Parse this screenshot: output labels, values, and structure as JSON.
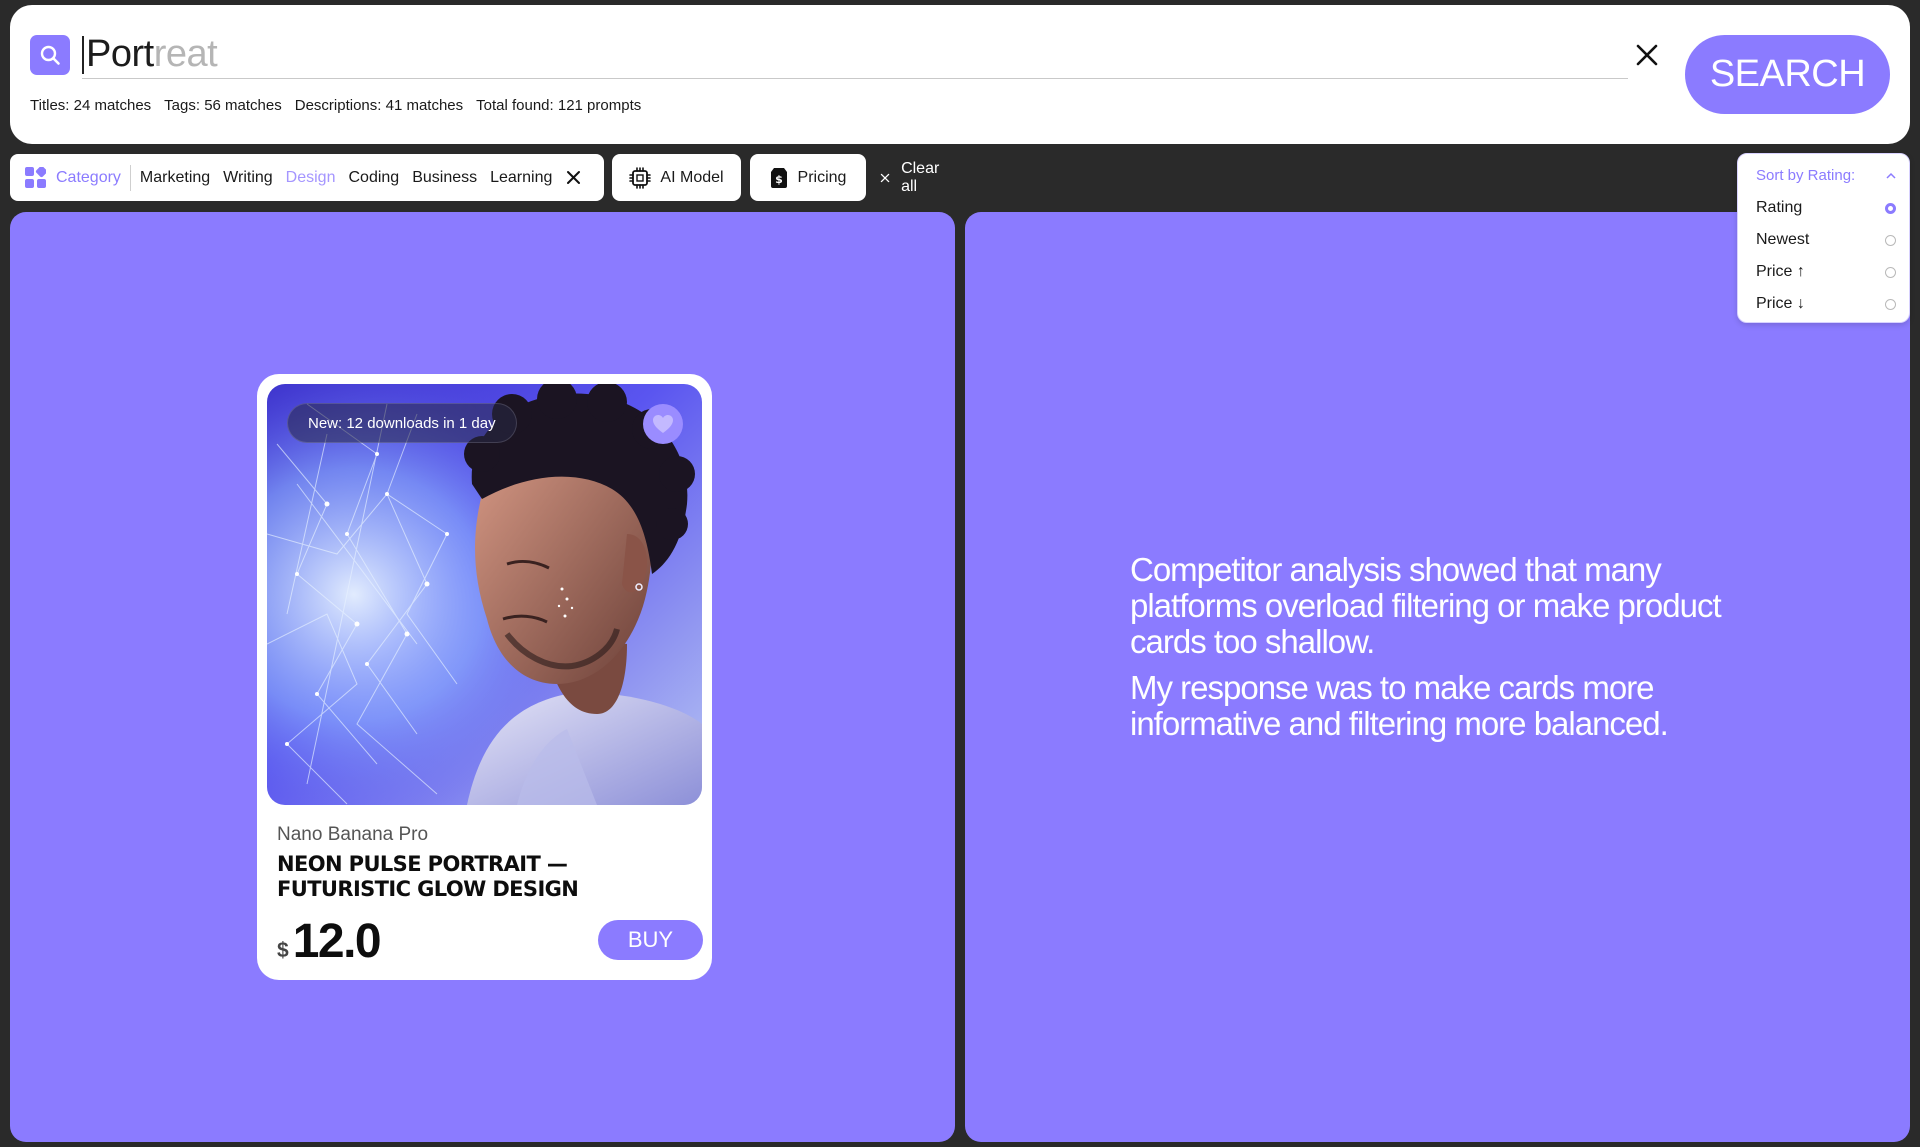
{
  "search": {
    "typed": "Port",
    "suggestion": "reat",
    "button_label": "SEARCH",
    "stats": [
      "Titles: 24 matches",
      "Tags: 56 matches",
      "Descriptions: 41 matches",
      "Total found: 121 prompts"
    ]
  },
  "filters": {
    "category_label": "Category",
    "categories": [
      "Marketing",
      "Writing",
      "Design",
      "Coding",
      "Business",
      "Learning"
    ],
    "active_category": "Design",
    "model_label": "AI Model",
    "pricing_label": "Pricing",
    "clear_all_label": "Clear all"
  },
  "sort": {
    "label": "Sort by Rating:",
    "options": [
      "Rating",
      "Newest",
      "Price ↑",
      "Price ↓"
    ],
    "selected": "Rating"
  },
  "product": {
    "badge": "New: 12 downloads in 1 day",
    "model": "Nano Banana Pro",
    "title": "Neon Pulse Portrait — Futuristic Glow Design",
    "currency": "$",
    "price": "12.0",
    "buy_label": "BUY"
  },
  "insight": {
    "paragraph_1": "Competitor analysis showed that many platforms overload filtering or make product cards too shallow.",
    "paragraph_2": "My response was to make cards more informative and filtering more balanced."
  },
  "colors": {
    "accent": "#8b7bff",
    "active_category": "#a596ff",
    "background": "#2a2a2a"
  },
  "icons": {
    "search": "search-icon",
    "clear": "close-icon",
    "category": "grid-icon",
    "model": "chip-icon",
    "pricing": "price-tag-icon",
    "favorite": "heart-icon",
    "sort": "chevron-up-icon"
  }
}
